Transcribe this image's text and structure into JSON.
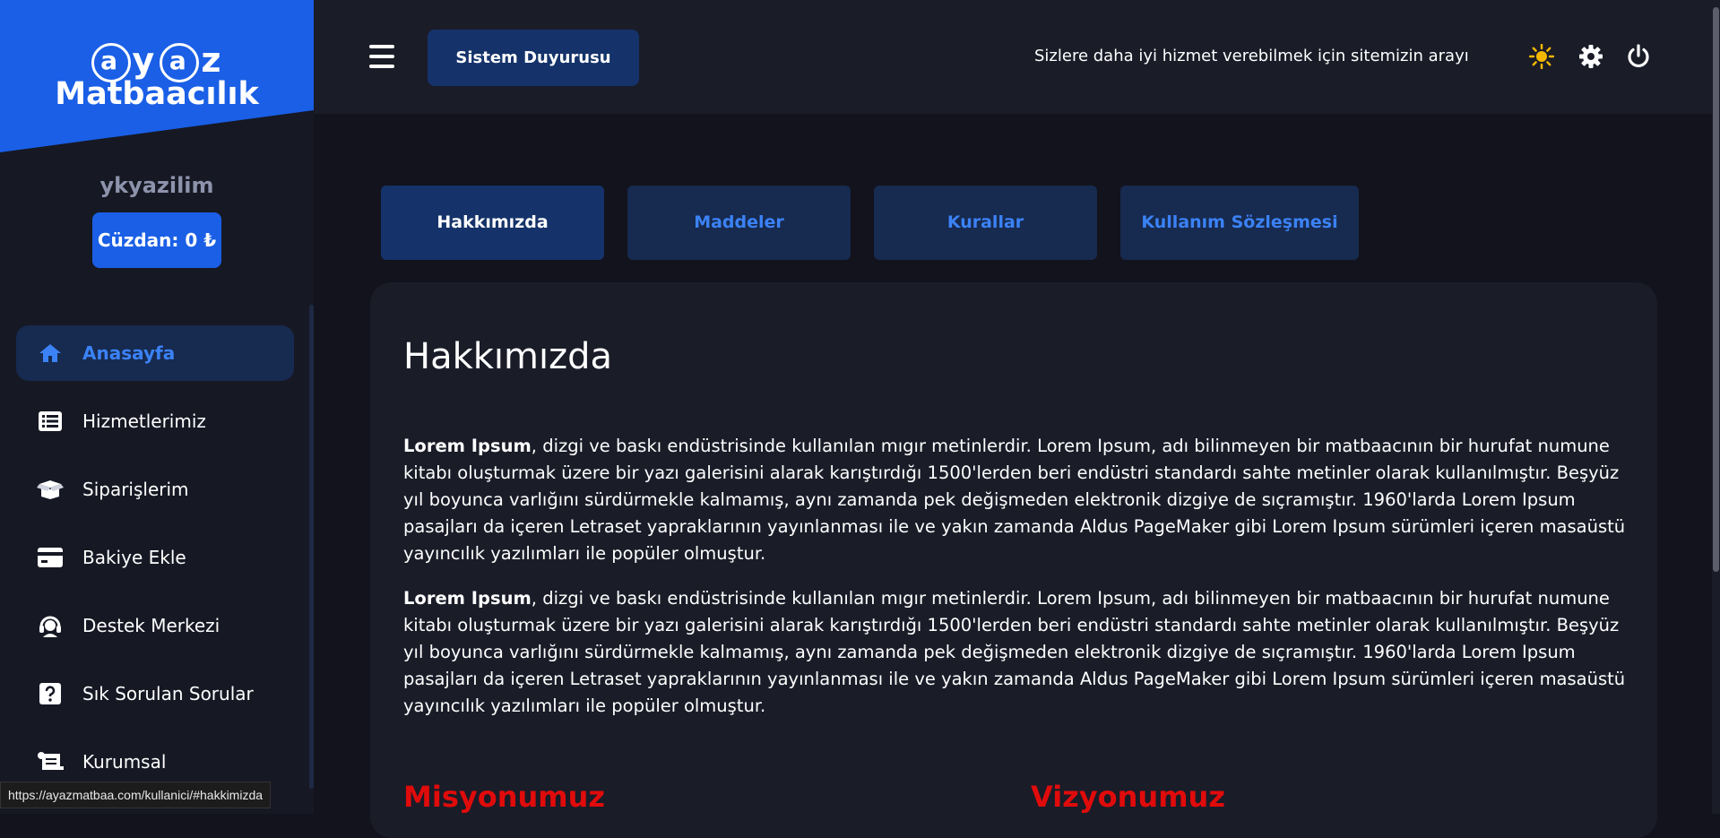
{
  "brand": {
    "logo_line1": [
      "a",
      "y",
      "a",
      "z"
    ],
    "logo_line2": "Matbaacılık"
  },
  "user": {
    "name": "ykyazilim",
    "wallet": "Cüzdan: 0 ₺"
  },
  "sidebar": {
    "items": [
      {
        "label": "Anasayfa",
        "icon": "home-icon"
      },
      {
        "label": "Hizmetlerimiz",
        "icon": "list-icon"
      },
      {
        "label": "Siparişlerim",
        "icon": "box-open-icon"
      },
      {
        "label": "Bakiye Ekle",
        "icon": "credit-card-icon"
      },
      {
        "label": "Destek Merkezi",
        "icon": "headset-icon"
      },
      {
        "label": "Sık Sorulan Sorular",
        "icon": "question-icon"
      },
      {
        "label": "Kurumsal",
        "icon": "scroll-icon"
      }
    ]
  },
  "topbar": {
    "announcement_button": "Sistem Duyurusu",
    "marquee": "Sizlere daha iyi hizmet verebilmek için sitemizin arayı",
    "icons": [
      "sun-icon",
      "gear-icon",
      "power-icon"
    ]
  },
  "tabs": [
    "Hakkımızda",
    "Maddeler",
    "Kurallar",
    "Kullanım Sözleşmesi"
  ],
  "content": {
    "title": "Hakkımızda",
    "paragraphs": [
      {
        "bold": "Lorem Ipsum",
        "text": ", dizgi ve baskı endüstrisinde kullanılan mıgır metinlerdir. Lorem Ipsum, adı bilinmeyen bir matbaacının bir hurufat numune kitabı oluşturmak üzere bir yazı galerisini alarak karıştırdığı 1500'lerden beri endüstri standardı sahte metinler olarak kullanılmıştır. Beşyüz yıl boyunca varlığını sürdürmekle kalmamış, aynı zamanda pek değişmeden elektronik dizgiye de sıçramıştır. 1960'larda Lorem Ipsum pasajları da içeren Letraset yapraklarının yayınlanması ile ve yakın zamanda Aldus PageMaker gibi Lorem Ipsum sürümleri içeren masaüstü yayıncılık yazılımları ile popüler olmuştur."
      },
      {
        "bold": "Lorem Ipsum",
        "text": ", dizgi ve baskı endüstrisinde kullanılan mıgır metinlerdir. Lorem Ipsum, adı bilinmeyen bir matbaacının bir hurufat numune kitabı oluşturmak üzere bir yazı galerisini alarak karıştırdığı 1500'lerden beri endüstri standardı sahte metinler olarak kullanılmıştır. Beşyüz yıl boyunca varlığını sürdürmekle kalmamış, aynı zamanda pek değişmeden elektronik dizgiye de sıçramıştır. 1960'larda Lorem Ipsum pasajları da içeren Letraset yapraklarının yayınlanması ile ve yakın zamanda Aldus PageMaker gibi Lorem Ipsum sürümleri içeren masaüstü yayıncılık yazılımları ile popüler olmuştur."
      }
    ],
    "mission": "Misyonumuz",
    "vision": "Vizyonumuz"
  },
  "status_url": "https://ayazmatbaa.com/kullanici/#hakkimizda",
  "colors": {
    "accent": "#1a5fe6",
    "active_text": "#3b82f6",
    "tab_bg": "#172a4f",
    "heading_red": "#e00b0b"
  }
}
